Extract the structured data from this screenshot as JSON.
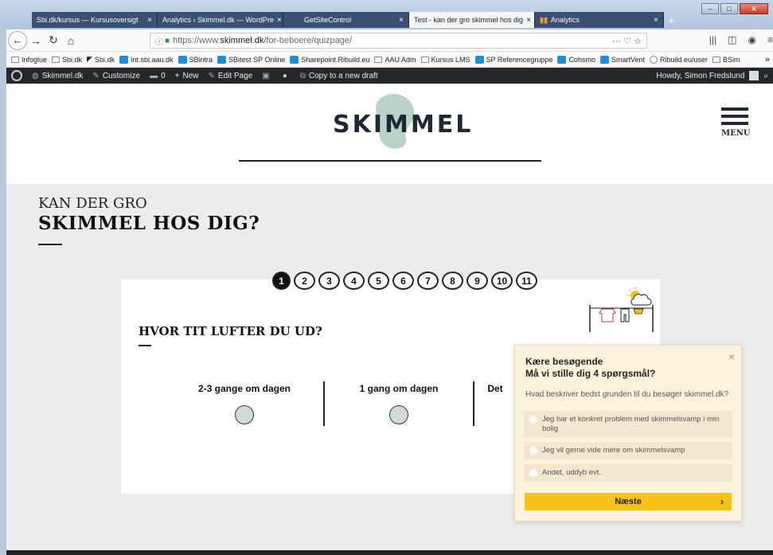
{
  "browser": {
    "tabs": [
      {
        "label": "Sbi.dk/kursus — Kursusoversigt",
        "active": false
      },
      {
        "label": "Analytics ‹ Skimmel.dk — WordPre",
        "active": false
      },
      {
        "label": "GetSiteControl",
        "active": false
      },
      {
        "label": "Test - kan der gro skimmel hos dig",
        "active": true
      },
      {
        "label": "Analytics",
        "active": false
      }
    ],
    "tab_close": "×",
    "new_tab": "+",
    "window_buttons": [
      "–",
      "□",
      "✕"
    ],
    "url_prefix": "https://www.",
    "url_host": "skimmel.dk",
    "url_path": "/for-beboere/quizpage/",
    "url_actions": "··· ♡ ☆",
    "bookmarks": [
      {
        "label": "Infoglue",
        "icon": "folder"
      },
      {
        "label": "Sbi.dk",
        "icon": "folder"
      },
      {
        "label": "Sbi.dk",
        "icon": "sbi"
      },
      {
        "label": "Int.sbi.aau.dk",
        "icon": "sharepoint"
      },
      {
        "label": "SBintra",
        "icon": "sharepoint"
      },
      {
        "label": "SBitest SP Online",
        "icon": "sharepoint"
      },
      {
        "label": "Sharepoint.Ribuild.eu",
        "icon": "sharepoint"
      },
      {
        "label": "AAU Adm",
        "icon": "folder"
      },
      {
        "label": "Kursus LMS",
        "icon": "folder"
      },
      {
        "label": "SP Referencegruppe",
        "icon": "sharepoint"
      },
      {
        "label": "Cohsmo",
        "icon": "sharepoint"
      },
      {
        "label": "SmartVent",
        "icon": "sharepoint"
      },
      {
        "label": "Ribuild.eu/user",
        "icon": "globe"
      },
      {
        "label": "BSim",
        "icon": "folder"
      }
    ],
    "bookmarks_more": "»"
  },
  "wpbar": {
    "site": "Skimmel.dk",
    "customize": "Customize",
    "comments": "0",
    "new": "New",
    "edit": "Edit Page",
    "copy": "Copy to a new draft",
    "howdy": "Howdy, Simon Fredslund"
  },
  "site": {
    "logo": "SKIMMEL",
    "menu_label": "MENU",
    "kicker": "KAN DER GRO",
    "headline": "SKIMMEL HOS DIG?",
    "steps": [
      "1",
      "2",
      "3",
      "4",
      "5",
      "6",
      "7",
      "8",
      "9",
      "10",
      "11"
    ],
    "active_step": 1,
    "question": "HVOR TIT LUFTER DU UD?",
    "answers": [
      "2-3 gange om dagen",
      "1 gang om dagen",
      "Det"
    ]
  },
  "popup": {
    "greeting_line1": "Kære besøgende",
    "greeting_line2": "Må vi stille dig 4 spørgsmål?",
    "question": "Hvad beskriver bedst grunden til du besøger skimmel.dk?",
    "options": [
      "Jeg har et konkret problem med skimmelsvamp i min bolig",
      "Jeg vil gerne vide mere om skimmelsvamp",
      "Andet, uddyb evt."
    ],
    "button": "Næste",
    "close": "×"
  },
  "colors": {
    "accent_yellow": "#f7c218",
    "logo_blob": "#b9d2cb",
    "answer_dot": "#cfdad9",
    "tab_bar": "#3a4f72"
  }
}
